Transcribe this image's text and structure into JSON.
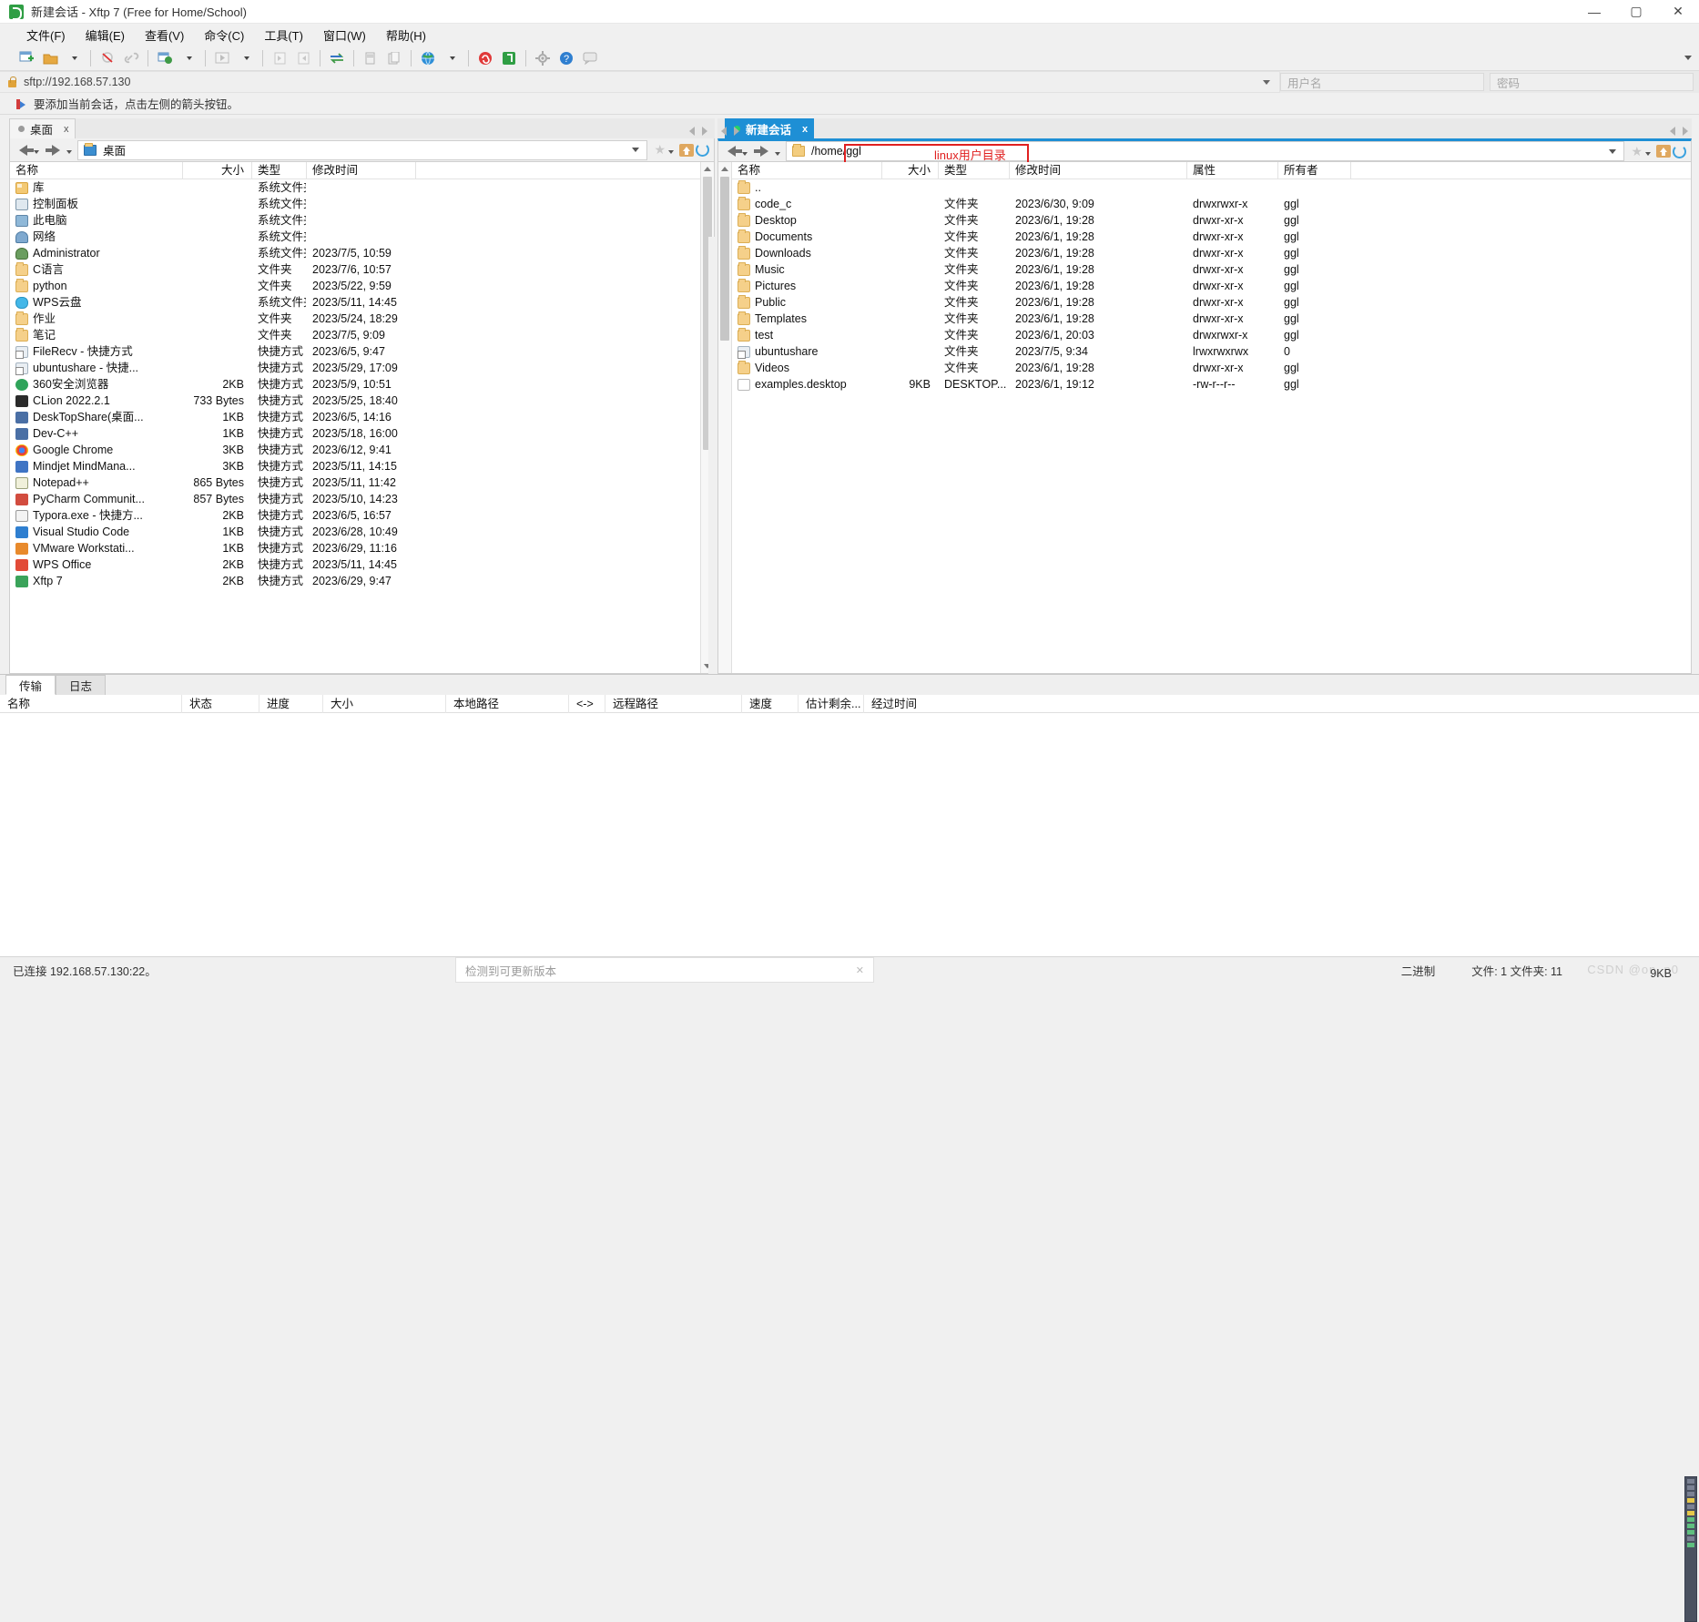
{
  "window": {
    "title": "新建会话 - Xftp 7 (Free for Home/School)",
    "minimize": "—",
    "maximize": "▢",
    "close": "✕"
  },
  "menu": [
    "文件(F)",
    "编辑(E)",
    "查看(V)",
    "命令(C)",
    "工具(T)",
    "窗口(W)",
    "帮助(H)"
  ],
  "address": {
    "url": "sftp://192.168.57.130",
    "username_placeholder": "用户名",
    "password_placeholder": "密码"
  },
  "hint": "要添加当前会话，点击左侧的箭头按钮。",
  "left_pane": {
    "tab_label": "桌面",
    "tab_close": "x",
    "path": "桌面",
    "columns": [
      "名称",
      "大小",
      "类型",
      "修改时间"
    ],
    "rows": [
      {
        "name": "库",
        "size": "",
        "type": "系统文件夹",
        "modified": "",
        "icon": "sysfolder"
      },
      {
        "name": "控制面板",
        "size": "",
        "type": "系统文件夹",
        "modified": "",
        "icon": "panel"
      },
      {
        "name": "此电脑",
        "size": "",
        "type": "系统文件夹",
        "modified": "",
        "icon": "pc"
      },
      {
        "name": "网络",
        "size": "",
        "type": "系统文件夹",
        "modified": "",
        "icon": "net"
      },
      {
        "name": "Administrator",
        "size": "",
        "type": "系统文件夹",
        "modified": "2023/7/5, 10:59",
        "icon": "user"
      },
      {
        "name": "C语言",
        "size": "",
        "type": "文件夹",
        "modified": "2023/7/6, 10:57",
        "icon": "folder"
      },
      {
        "name": "python",
        "size": "",
        "type": "文件夹",
        "modified": "2023/5/22, 9:59",
        "icon": "folder"
      },
      {
        "name": "WPS云盘",
        "size": "",
        "type": "系统文件夹",
        "modified": "2023/5/11, 14:45",
        "icon": "cloud"
      },
      {
        "name": "作业",
        "size": "",
        "type": "文件夹",
        "modified": "2023/5/24, 18:29",
        "icon": "folder"
      },
      {
        "name": "笔记",
        "size": "",
        "type": "文件夹",
        "modified": "2023/7/5, 9:09",
        "icon": "folder"
      },
      {
        "name": "FileRecv - 快捷方式",
        "size": "",
        "type": "快捷方式",
        "modified": "2023/6/5, 9:47",
        "icon": "link"
      },
      {
        "name": "ubuntushare - 快捷...",
        "size": "",
        "type": "快捷方式",
        "modified": "2023/5/29, 17:09",
        "icon": "link"
      },
      {
        "name": "360安全浏览器",
        "size": "2KB",
        "type": "快捷方式",
        "modified": "2023/5/9, 10:51",
        "icon": "360"
      },
      {
        "name": "CLion 2022.2.1",
        "size": "733 Bytes",
        "type": "快捷方式",
        "modified": "2023/5/25, 18:40",
        "icon": "clion"
      },
      {
        "name": "DeskTopShare(桌面...",
        "size": "1KB",
        "type": "快捷方式",
        "modified": "2023/6/5, 14:16",
        "icon": "dev"
      },
      {
        "name": "Dev-C++",
        "size": "1KB",
        "type": "快捷方式",
        "modified": "2023/5/18, 16:00",
        "icon": "dev"
      },
      {
        "name": "Google Chrome",
        "size": "3KB",
        "type": "快捷方式",
        "modified": "2023/6/12, 9:41",
        "icon": "chrome"
      },
      {
        "name": "Mindjet MindMana...",
        "size": "3KB",
        "type": "快捷方式",
        "modified": "2023/5/11, 14:15",
        "icon": "mind"
      },
      {
        "name": "Notepad++",
        "size": "865 Bytes",
        "type": "快捷方式",
        "modified": "2023/5/11, 11:42",
        "icon": "np"
      },
      {
        "name": "PyCharm Communit...",
        "size": "857 Bytes",
        "type": "快捷方式",
        "modified": "2023/5/10, 14:23",
        "icon": "pc2"
      },
      {
        "name": "Typora.exe - 快捷方...",
        "size": "2KB",
        "type": "快捷方式",
        "modified": "2023/6/5, 16:57",
        "icon": "typ"
      },
      {
        "name": "Visual Studio Code",
        "size": "1KB",
        "type": "快捷方式",
        "modified": "2023/6/28, 10:49",
        "icon": "vs"
      },
      {
        "name": "VMware Workstati...",
        "size": "1KB",
        "type": "快捷方式",
        "modified": "2023/6/29, 11:16",
        "icon": "vmw"
      },
      {
        "name": "WPS Office",
        "size": "2KB",
        "type": "快捷方式",
        "modified": "2023/5/11, 14:45",
        "icon": "wps"
      },
      {
        "name": "Xftp 7",
        "size": "2KB",
        "type": "快捷方式",
        "modified": "2023/6/29, 9:47",
        "icon": "xftp"
      }
    ]
  },
  "right_pane": {
    "tab_label": "新建会话",
    "tab_close": "x",
    "path": "/home/ggl",
    "annotation": "linux用户目录",
    "annotation_color": "#e02020",
    "columns": [
      "名称",
      "大小",
      "类型",
      "修改时间",
      "属性",
      "所有者"
    ],
    "rows": [
      {
        "name": "..",
        "size": "",
        "type": "",
        "modified": "",
        "attrs": "",
        "owner": "",
        "icon": "folder"
      },
      {
        "name": "code_c",
        "size": "",
        "type": "文件夹",
        "modified": "2023/6/30, 9:09",
        "attrs": "drwxrwxr-x",
        "owner": "ggl",
        "icon": "folder"
      },
      {
        "name": "Desktop",
        "size": "",
        "type": "文件夹",
        "modified": "2023/6/1, 19:28",
        "attrs": "drwxr-xr-x",
        "owner": "ggl",
        "icon": "folder"
      },
      {
        "name": "Documents",
        "size": "",
        "type": "文件夹",
        "modified": "2023/6/1, 19:28",
        "attrs": "drwxr-xr-x",
        "owner": "ggl",
        "icon": "folder"
      },
      {
        "name": "Downloads",
        "size": "",
        "type": "文件夹",
        "modified": "2023/6/1, 19:28",
        "attrs": "drwxr-xr-x",
        "owner": "ggl",
        "icon": "folder"
      },
      {
        "name": "Music",
        "size": "",
        "type": "文件夹",
        "modified": "2023/6/1, 19:28",
        "attrs": "drwxr-xr-x",
        "owner": "ggl",
        "icon": "folder"
      },
      {
        "name": "Pictures",
        "size": "",
        "type": "文件夹",
        "modified": "2023/6/1, 19:28",
        "attrs": "drwxr-xr-x",
        "owner": "ggl",
        "icon": "folder"
      },
      {
        "name": "Public",
        "size": "",
        "type": "文件夹",
        "modified": "2023/6/1, 19:28",
        "attrs": "drwxr-xr-x",
        "owner": "ggl",
        "icon": "folder"
      },
      {
        "name": "Templates",
        "size": "",
        "type": "文件夹",
        "modified": "2023/6/1, 19:28",
        "attrs": "drwxr-xr-x",
        "owner": "ggl",
        "icon": "folder"
      },
      {
        "name": "test",
        "size": "",
        "type": "文件夹",
        "modified": "2023/6/1, 20:03",
        "attrs": "drwxrwxr-x",
        "owner": "ggl",
        "icon": "folder"
      },
      {
        "name": "ubuntushare",
        "size": "",
        "type": "文件夹",
        "modified": "2023/7/5, 9:34",
        "attrs": "lrwxrwxrwx",
        "owner": "0",
        "icon": "link"
      },
      {
        "name": "Videos",
        "size": "",
        "type": "文件夹",
        "modified": "2023/6/1, 19:28",
        "attrs": "drwxr-xr-x",
        "owner": "ggl",
        "icon": "folder"
      },
      {
        "name": "examples.desktop",
        "size": "9KB",
        "type": "DESKTOP...",
        "modified": "2023/6/1, 19:12",
        "attrs": "-rw-r--r--",
        "owner": "ggl",
        "icon": "file"
      }
    ]
  },
  "transfer": {
    "tabs": [
      "传输",
      "日志"
    ],
    "active_tab": "传输",
    "columns": [
      "名称",
      "状态",
      "进度",
      "大小",
      "本地路径",
      "<->",
      "远程路径",
      "速度",
      "估计剩余...",
      "经过时间"
    ]
  },
  "status": {
    "connection": "已连接 192.168.57.130:22。",
    "update_notice": "检测到可更新版本",
    "update_close": "✕",
    "transfer_mode": "二进制",
    "counts": "文件: 1 文件夹: 11",
    "selected_size": "9KB",
    "watermark": "CSDN @on_n0"
  }
}
